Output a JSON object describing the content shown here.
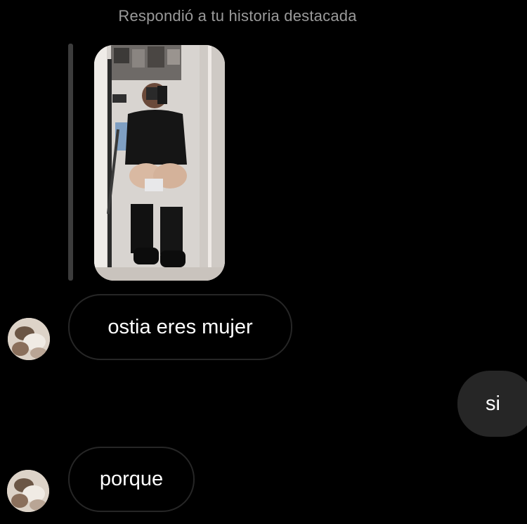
{
  "header": {
    "reply_context": "Respondió a tu historia destacada"
  },
  "story_reply": {
    "thumbnail_icon": "story-photo-thumbnail"
  },
  "messages": [
    {
      "direction": "incoming",
      "text": "ostia eres mujer",
      "avatar_icon": "user-avatar-icon"
    },
    {
      "direction": "outgoing",
      "text": "si"
    },
    {
      "direction": "incoming",
      "text": "porque",
      "avatar_icon": "user-avatar-icon"
    }
  ],
  "colors": {
    "background": "#000000",
    "incoming_bubble_border": "#262626",
    "outgoing_bubble_fill": "#262626",
    "meta_text": "#9a9a9a",
    "text": "#ffffff"
  }
}
